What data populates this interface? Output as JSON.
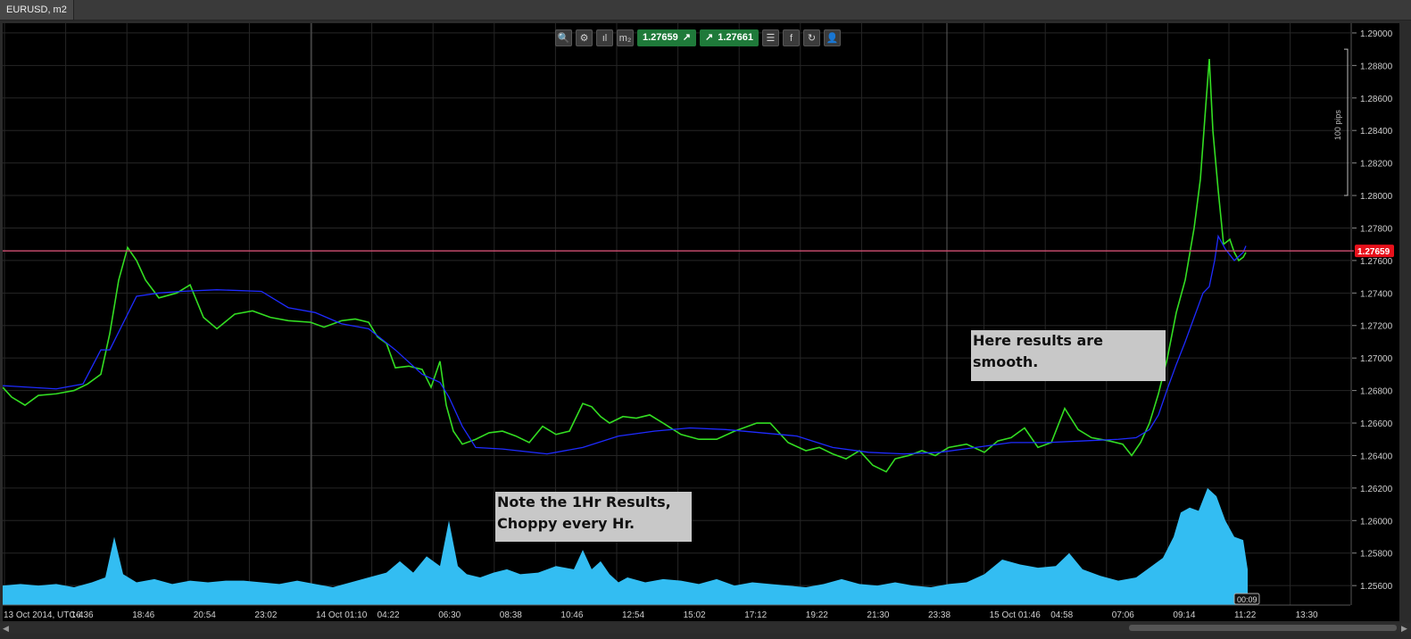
{
  "window": {
    "tab_title": "EURUSD, m2"
  },
  "toolbar": {
    "buttons": [
      {
        "name": "zoom-icon",
        "glyph": "🔍"
      },
      {
        "name": "chart-settings-icon",
        "glyph": "⚙"
      },
      {
        "name": "candles-icon",
        "glyph": "ıl"
      },
      {
        "name": "timeframe-icon",
        "glyph": "m₂"
      }
    ],
    "bid": {
      "label": "1.27659",
      "arrow": "↗"
    },
    "ask": {
      "label": "1.27661",
      "arrow": "↗"
    },
    "right_buttons": [
      {
        "name": "list-icon",
        "glyph": "☰"
      },
      {
        "name": "facebook-icon",
        "glyph": "f"
      },
      {
        "name": "share-icon",
        "glyph": "↻"
      },
      {
        "name": "user-icon",
        "glyph": "👤"
      }
    ]
  },
  "notes": {
    "smooth": "Here results are smooth.",
    "hourly_line1": "Note the 1Hr Results,",
    "hourly_line2": "Choppy every Hr."
  },
  "chart_data": {
    "type": "line",
    "symbol": "EURUSD",
    "timeframe": "m2",
    "ylim": [
      1.2548,
      1.2906
    ],
    "y_ticks": [
      "1.29000",
      "1.28800",
      "1.28600",
      "1.28400",
      "1.28200",
      "1.28000",
      "1.27800",
      "1.27600",
      "1.27400",
      "1.27200",
      "1.27000",
      "1.26800",
      "1.26600",
      "1.26400",
      "1.26200",
      "1.26000",
      "1.25800",
      "1.25600"
    ],
    "x_tick_labels": [
      "13 Oct 2014, UTC-4",
      "16:36",
      "18:46",
      "20:54",
      "23:02",
      "14 Oct 01:10",
      "04:22",
      "06:30",
      "08:38",
      "10:46",
      "12:54",
      "15:02",
      "17:12",
      "19:22",
      "21:30",
      "23:38",
      "15 Oct 01:46",
      "04:58",
      "07:06",
      "09:14",
      "11:22",
      "13:30"
    ],
    "current_price": "1.27659",
    "current_price_value": 1.27659,
    "countdown": "00:09",
    "pips_marker": "100 pips",
    "grid": true,
    "series": [
      {
        "color": "#33dd22",
        "x": [
          0,
          10,
          25,
          40,
          60,
          80,
          95,
          110,
          120,
          130,
          140,
          150,
          160,
          175,
          195,
          210,
          225,
          240,
          260,
          280,
          300,
          320,
          345,
          360,
          380,
          395,
          410,
          420,
          430,
          440,
          455,
          470,
          480,
          490,
          497,
          505,
          515,
          530,
          545,
          560,
          575,
          590,
          605,
          620,
          635,
          650,
          660,
          670,
          680,
          695,
          710,
          725,
          740,
          760,
          780,
          800,
          820,
          845,
          860,
          880,
          900,
          915,
          930,
          945,
          960,
          975,
          990,
          1000,
          1015,
          1030,
          1045,
          1060,
          1080,
          1100,
          1115,
          1130,
          1145,
          1160,
          1175,
          1190,
          1205,
          1220,
          1240,
          1255,
          1265,
          1275,
          1285,
          1295,
          1305,
          1315,
          1325,
          1335,
          1342,
          1348,
          1352,
          1356,
          1362,
          1368,
          1375,
          1380,
          1385,
          1390,
          1393
        ],
        "y": [
          1.2682,
          1.2676,
          1.2671,
          1.2677,
          1.2678,
          1.268,
          1.2684,
          1.269,
          1.2715,
          1.2748,
          1.2768,
          1.276,
          1.2748,
          1.2737,
          1.274,
          1.2745,
          1.2725,
          1.2718,
          1.2727,
          1.2729,
          1.2725,
          1.2723,
          1.2722,
          1.2719,
          1.2723,
          1.2724,
          1.2722,
          1.2713,
          1.2709,
          1.2694,
          1.2695,
          1.2693,
          1.2682,
          1.2698,
          1.2671,
          1.2655,
          1.2647,
          1.265,
          1.2654,
          1.2655,
          1.2652,
          1.2648,
          1.2658,
          1.2653,
          1.2655,
          1.2672,
          1.267,
          1.2664,
          1.266,
          1.2664,
          1.2663,
          1.2665,
          1.266,
          1.2653,
          1.265,
          1.265,
          1.2655,
          1.266,
          1.266,
          1.2648,
          1.2643,
          1.2645,
          1.2641,
          1.2638,
          1.2643,
          1.2634,
          1.263,
          1.2638,
          1.264,
          1.2643,
          1.264,
          1.2645,
          1.2647,
          1.2642,
          1.2649,
          1.2651,
          1.2657,
          1.2645,
          1.2648,
          1.2669,
          1.2656,
          1.2651,
          1.2649,
          1.2647,
          1.264,
          1.2648,
          1.266,
          1.2678,
          1.27,
          1.2728,
          1.2748,
          1.278,
          1.281,
          1.2855,
          1.2884,
          1.284,
          1.2803,
          1.277,
          1.2773,
          1.2765,
          1.276,
          1.2762,
          1.2765
        ]
      },
      {
        "color": "#1e2bff",
        "x": [
          0,
          60,
          90,
          110,
          120,
          150,
          175,
          200,
          240,
          290,
          320,
          350,
          380,
          410,
          440,
          470,
          490,
          500,
          515,
          530,
          560,
          610,
          650,
          690,
          730,
          770,
          810,
          850,
          890,
          930,
          970,
          1010,
          1050,
          1090,
          1130,
          1170,
          1210,
          1250,
          1270,
          1285,
          1295,
          1305,
          1315,
          1325,
          1335,
          1345,
          1352,
          1358,
          1362,
          1370,
          1380,
          1390,
          1393
        ],
        "y": [
          1.2683,
          1.2681,
          1.2684,
          1.2705,
          1.2705,
          1.2738,
          1.274,
          1.2741,
          1.2742,
          1.2741,
          1.2731,
          1.2728,
          1.2721,
          1.2718,
          1.2705,
          1.269,
          1.2685,
          1.2676,
          1.2658,
          1.2645,
          1.2644,
          1.2641,
          1.2645,
          1.2652,
          1.2655,
          1.2657,
          1.2656,
          1.2654,
          1.2652,
          1.2645,
          1.2642,
          1.2641,
          1.2642,
          1.2645,
          1.2648,
          1.2648,
          1.2649,
          1.265,
          1.2651,
          1.2656,
          1.2665,
          1.2681,
          1.2696,
          1.271,
          1.2725,
          1.274,
          1.2744,
          1.276,
          1.2775,
          1.2767,
          1.276,
          1.2765,
          1.2769
        ]
      }
    ],
    "volume": {
      "color": "#33bdf2",
      "x": [
        0,
        20,
        40,
        60,
        80,
        100,
        115,
        125,
        135,
        150,
        170,
        190,
        210,
        230,
        250,
        270,
        290,
        310,
        330,
        350,
        370,
        390,
        410,
        430,
        445,
        460,
        475,
        490,
        500,
        510,
        520,
        535,
        550,
        565,
        580,
        600,
        620,
        640,
        650,
        660,
        670,
        680,
        690,
        700,
        720,
        740,
        760,
        780,
        800,
        820,
        840,
        860,
        880,
        900,
        920,
        940,
        960,
        980,
        1000,
        1020,
        1040,
        1060,
        1080,
        1100,
        1120,
        1140,
        1160,
        1180,
        1195,
        1210,
        1230,
        1250,
        1270,
        1285,
        1300,
        1312,
        1320,
        1330,
        1340,
        1350,
        1360,
        1370,
        1380,
        1390,
        1395
      ],
      "y": [
        1.256,
        1.2561,
        1.256,
        1.2561,
        1.2559,
        1.2562,
        1.2565,
        1.259,
        1.2567,
        1.2562,
        1.2564,
        1.2561,
        1.2563,
        1.2562,
        1.2563,
        1.2563,
        1.2562,
        1.2561,
        1.2563,
        1.2561,
        1.2559,
        1.2562,
        1.2565,
        1.2568,
        1.2575,
        1.2568,
        1.2578,
        1.2572,
        1.26,
        1.2572,
        1.2567,
        1.2565,
        1.2568,
        1.257,
        1.2567,
        1.2568,
        1.2572,
        1.257,
        1.2582,
        1.257,
        1.2575,
        1.2567,
        1.2562,
        1.2565,
        1.2562,
        1.2564,
        1.2563,
        1.2561,
        1.2564,
        1.256,
        1.2562,
        1.2561,
        1.256,
        1.2559,
        1.2561,
        1.2564,
        1.2561,
        1.256,
        1.2562,
        1.256,
        1.2559,
        1.2561,
        1.2562,
        1.2567,
        1.2576,
        1.2573,
        1.2571,
        1.2572,
        1.258,
        1.257,
        1.2566,
        1.2563,
        1.2565,
        1.2571,
        1.2577,
        1.259,
        1.2605,
        1.2608,
        1.2606,
        1.262,
        1.2615,
        1.26,
        1.259,
        1.2588,
        1.257
      ]
    }
  }
}
